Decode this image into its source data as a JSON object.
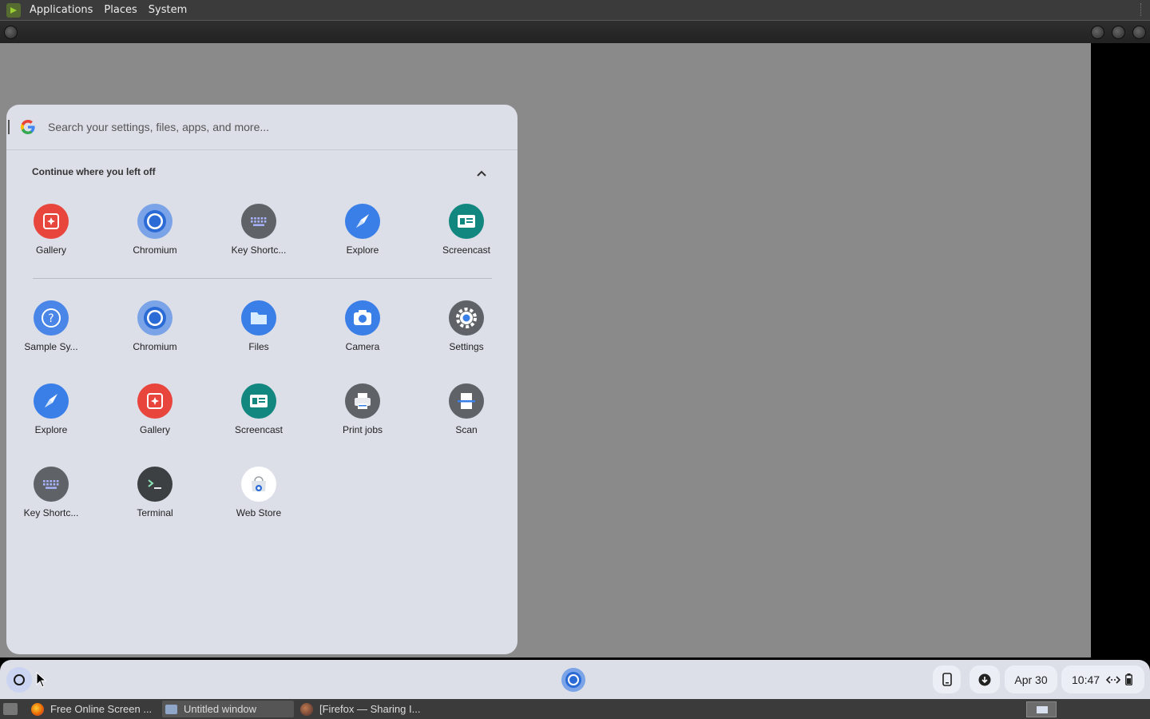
{
  "top_panel": {
    "menus": [
      "Applications",
      "Places",
      "System"
    ]
  },
  "launcher": {
    "search": {
      "placeholder": "Search your settings, files, apps, and more..."
    },
    "continue_section": {
      "title": "Continue where you left off"
    },
    "recent_apps": [
      {
        "label": "Gallery",
        "icon": "gallery-icon",
        "color": "#e8453c"
      },
      {
        "label": "Chromium",
        "icon": "chromium-icon",
        "color": "#4a7fd4"
      },
      {
        "label": "Key Shortc...",
        "icon": "keyboard-icon",
        "color": "#5f6368"
      },
      {
        "label": "Explore",
        "icon": "explore-icon",
        "color": "#3a7ee8"
      },
      {
        "label": "Screencast",
        "icon": "screencast-icon",
        "color": "#12877f"
      }
    ],
    "apps": [
      {
        "label": "Sample Sy...",
        "icon": "help-icon",
        "color": "#4a86e8"
      },
      {
        "label": "Chromium",
        "icon": "chromium-icon",
        "color": "#4a7fd4"
      },
      {
        "label": "Files",
        "icon": "files-icon",
        "color": "#3a7ee8"
      },
      {
        "label": "Camera",
        "icon": "camera-icon",
        "color": "#3a7ee8"
      },
      {
        "label": "Settings",
        "icon": "settings-icon",
        "color": "#5f6368"
      },
      {
        "label": "Explore",
        "icon": "explore-icon",
        "color": "#3a7ee8"
      },
      {
        "label": "Gallery",
        "icon": "gallery-icon",
        "color": "#e8453c"
      },
      {
        "label": "Screencast",
        "icon": "screencast-icon",
        "color": "#12877f"
      },
      {
        "label": "Print jobs",
        "icon": "print-icon",
        "color": "#5f6368"
      },
      {
        "label": "Scan",
        "icon": "scan-icon",
        "color": "#5f6368"
      },
      {
        "label": "Key Shortc...",
        "icon": "keyboard-icon",
        "color": "#5f6368"
      },
      {
        "label": "Terminal",
        "icon": "terminal-icon",
        "color": "#3c4043"
      },
      {
        "label": "Web Store",
        "icon": "webstore-icon",
        "color": "#ffffff"
      }
    ]
  },
  "shelf": {
    "date": "Apr 30",
    "time": "10:47"
  },
  "taskbar": {
    "tasks": [
      {
        "label": "Free Online Screen ...",
        "icon": "firefox-icon"
      },
      {
        "label": "Untitled window",
        "icon": "window-icon"
      },
      {
        "label": "[Firefox — Sharing I...",
        "icon": "firefox-icon"
      }
    ]
  }
}
